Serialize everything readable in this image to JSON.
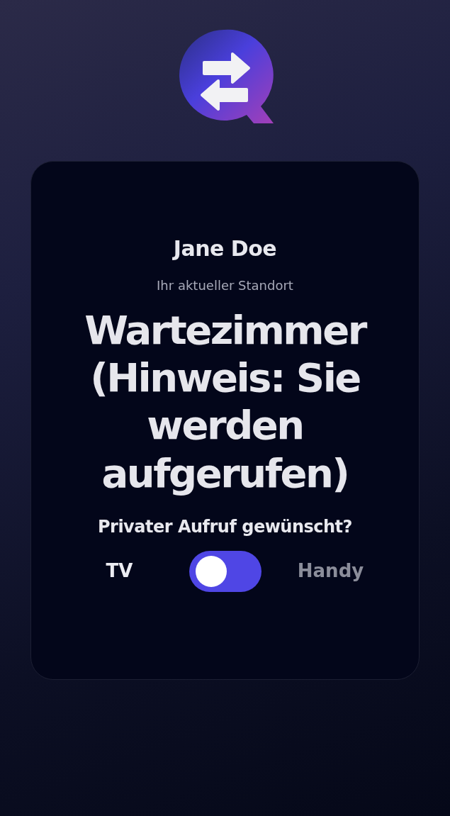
{
  "user": {
    "name": "Jane Doe"
  },
  "location": {
    "label": "Ihr aktueller Standort",
    "value": "Wartezimmer (Hinweis: Sie werden aufgerufen)"
  },
  "private_call": {
    "question": "Privater Aufruf gewünscht?",
    "on": false,
    "options": [
      {
        "label": "TV",
        "selected": true
      },
      {
        "label": "Handy",
        "selected": false
      }
    ]
  }
}
